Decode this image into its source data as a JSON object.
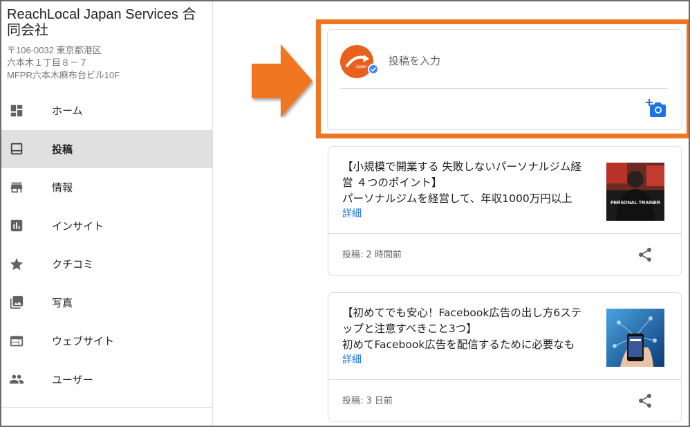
{
  "business": {
    "name": "ReachLocal Japan Services 合同会社",
    "address_lines": [
      "〒106-0032 東京都港区",
      "六本木１丁目８－７",
      "MFPR六本木麻布台ビル10F"
    ]
  },
  "nav": {
    "items": [
      {
        "label": "ホーム",
        "icon": "dashboard-icon"
      },
      {
        "label": "投稿",
        "icon": "posts-icon",
        "active": true
      },
      {
        "label": "情報",
        "icon": "storefront-icon"
      },
      {
        "label": "インサイト",
        "icon": "insights-icon"
      },
      {
        "label": "クチコミ",
        "icon": "star-icon"
      },
      {
        "label": "写真",
        "icon": "photo-icon"
      },
      {
        "label": "ウェブサイト",
        "icon": "website-icon"
      },
      {
        "label": "ユーザー",
        "icon": "users-icon"
      }
    ]
  },
  "compose": {
    "placeholder": "投稿を入力",
    "avatar_text": "Japan"
  },
  "posts": [
    {
      "title": "【小規模で開業する 失敗しないパーソナルジム経営 ４つのポイント】",
      "body": "パーソナルジムを経営して、年収1000万円以上",
      "more": "詳細",
      "time": "投稿: 2 時間前",
      "thumb_text": "PERSONAL TRAINER"
    },
    {
      "title": "【初めてでも安心！Facebook広告の出し方6ステップと注意すべきこと3つ】",
      "body": "初めてFacebook広告を配信するために必要なも",
      "more": "詳細",
      "time": "投稿: 3 日前"
    }
  ],
  "colors": {
    "highlight": "#f07622",
    "link": "#1a73e8",
    "verified": "#4285f4",
    "active_nav_bg": "#e0e0e0"
  }
}
